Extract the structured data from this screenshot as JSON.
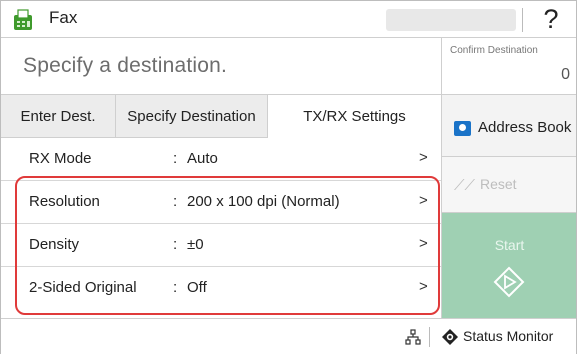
{
  "titlebar": {
    "title": "Fax",
    "help_label": "?"
  },
  "destination": {
    "placeholder": "Specify a destination.",
    "confirm_label": "Confirm Destination",
    "confirm_count": "0"
  },
  "tabs": [
    {
      "label": "Enter Dest."
    },
    {
      "label": "Specify Destination"
    },
    {
      "label": "TX/RX Settings"
    }
  ],
  "sidepanel": {
    "address_book_label": "Address Book",
    "reset_label": "Reset",
    "start_label": "Start"
  },
  "settings": [
    {
      "label": "RX Mode",
      "value": "Auto"
    },
    {
      "label": "Resolution",
      "value": "200 x 100 dpi (Normal)"
    },
    {
      "label": "Density",
      "value": "±0"
    },
    {
      "label": "2-Sided Original",
      "value": "Off"
    }
  ],
  "statusbar": {
    "status_monitor_label": "Status Monitor"
  },
  "colors": {
    "highlight": "#e03a3a",
    "start": "#9fd0b3",
    "fax_icon": "#3f9a2c",
    "address_book_icon": "#1a73c8"
  }
}
